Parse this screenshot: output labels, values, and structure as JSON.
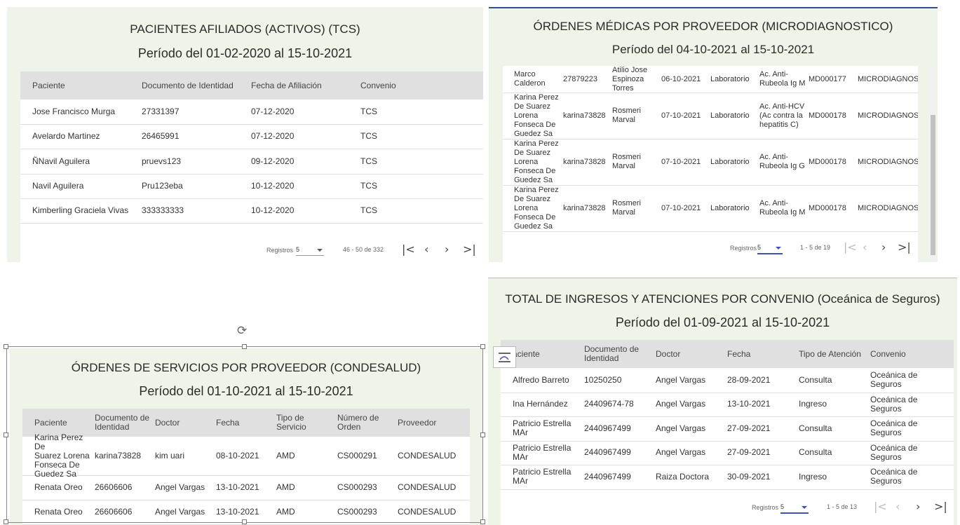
{
  "p1": {
    "title": "PACIENTES AFILIADOS (ACTIVOS) (TCS)",
    "period": "Período del 01-02-2020 al 15-10-2021",
    "headers": [
      "Paciente",
      "Documento de Identidad",
      "Fecha de Afiliación",
      "Convenio"
    ],
    "rows": [
      [
        "Jose Francisco Murga",
        "27331397",
        "07-12-2020",
        "TCS"
      ],
      [
        "Avelardo Martinez",
        "26465991",
        "07-12-2020",
        "TCS"
      ],
      [
        "ÑNavil Aguilera",
        "pruevs123",
        "09-12-2020",
        "TCS"
      ],
      [
        "Navil Aguilera",
        "Pru123eba",
        "10-12-2020",
        "TCS"
      ],
      [
        "Kimberling Graciela Vivas",
        "333333333",
        "10-12-2020",
        "TCS"
      ]
    ],
    "registros_label": "Registros",
    "page_size": "5",
    "range": "46 - 50 de 332"
  },
  "p2": {
    "title": "ÓRDENES MÉDICAS POR PROVEEDOR (MICRODIAGNOSTICO)",
    "period": "Período del 04-10-2021 al 15-10-2021",
    "rows": [
      [
        "Marco\nCalderon",
        "27879223",
        "Atilio Jose\nEspinoza\nTorres",
        "06-10-2021",
        "Laboratorio",
        "Ac. Anti-\nRubeola Ig M",
        "MD000177",
        "MICRODIAGNOSTI"
      ],
      [
        "Karina Perez\nDe Suarez\nLorena\nFonseca De\nGuedez Sa",
        "karina73828",
        "Rosmeri\nMarval",
        "07-10-2021",
        "Laboratorio",
        "Ac. Anti-HCV\n(Ac contra la\nhepatitis C)",
        "MD000178",
        "MICRODIAGNOSTI"
      ],
      [
        "Karina Perez\nDe Suarez\nLorena\nFonseca De\nGuedez Sa",
        "karina73828",
        "Rosmeri\nMarval",
        "07-10-2021",
        "Laboratorio",
        "Ac. Anti-\nRubeola Ig G",
        "MD000178",
        "MICRODIAGNOSTI"
      ],
      [
        "Karina Perez\nDe Suarez\nLorena\nFonseca De\nGuedez Sa",
        "karina73828",
        "Rosmeri\nMarval",
        "07-10-2021",
        "Laboratorio",
        "Ac. Anti-\nRubeola Ig M",
        "MD000178",
        "MICRODIAGNOSTI"
      ]
    ],
    "registros_label": "Registros",
    "page_size": "5",
    "range": "1 - 5 de 19"
  },
  "p3": {
    "title": "ÓRDENES DE SERVICIOS POR PROVEEDOR (CONDESALUD)",
    "period": "Período del 01-10-2021 al 15-10-2021",
    "headers": [
      "Paciente",
      "Documento de\nIdentidad",
      "Doctor",
      "Fecha",
      "Tipo de Servicio",
      "Número de\nOrden",
      "Proveedor"
    ],
    "rows": [
      [
        "Karina Perez De\nSuarez Lorena\nFonseca De\nGuedez Sa",
        "karina73828",
        "kim uari",
        "08-10-2021",
        "AMD",
        "CS000291",
        "CONDESALUD"
      ],
      [
        "Renata Oreo",
        "26606606",
        "Angel Vargas",
        "13-10-2021",
        "AMD",
        "CS000293",
        "CONDESALUD"
      ],
      [
        "Renata Oreo",
        "26606606",
        "Angel Vargas",
        "13-10-2021",
        "AMD",
        "CS000293",
        "CONDESALUD"
      ]
    ]
  },
  "p4": {
    "title": "TOTAL DE INGRESOS Y ATENCIONES POR CONVENIO (Oceánica de Seguros)",
    "period": "Período del 01-09-2021 al 15-10-2021",
    "headers": [
      "aciente",
      "Documento de\nIdentidad",
      "Doctor",
      "Fecha",
      "Tipo de Atención",
      "Convenio"
    ],
    "rows": [
      [
        "Alfredo Barreto",
        "10250250",
        "Angel Vargas",
        "28-09-2021",
        "Consulta",
        "Oceánica de\nSeguros"
      ],
      [
        "Ina Hernández",
        "24409674-78",
        "Angel Vargas",
        "13-10-2021",
        "Ingreso",
        "Oceánica de\nSeguros"
      ],
      [
        "Patricio Estrella\nMAr",
        "2440967499",
        "Angel Vargas",
        "27-09-2021",
        "Consulta",
        "Oceánica de\nSeguros"
      ],
      [
        "Patricio Estrella\nMAr",
        "2440967499",
        "Angel Vargas",
        "27-09-2021",
        "Consulta",
        "Oceánica de\nSeguros"
      ],
      [
        "Patricio Estrella\nMAr",
        "2440967499",
        "Raiza Doctora",
        "30-09-2021",
        "Ingreso",
        "Oceánica de\nSeguros"
      ]
    ],
    "registros_label": "Registros",
    "page_size": "5",
    "range": "1 - 5 de 13"
  },
  "nav_icons": [
    "first-page-icon",
    "prev-page-icon",
    "next-page-icon",
    "last-page-icon"
  ],
  "colors": {
    "panel_bg": "#eef4e8",
    "header_bg": "#e0e0e0",
    "accent": "#3f51b5"
  }
}
